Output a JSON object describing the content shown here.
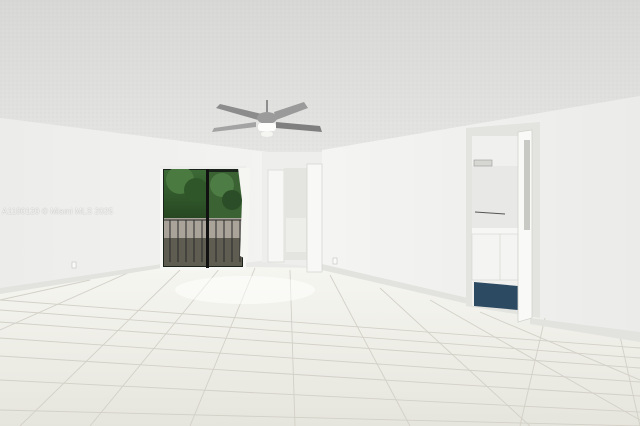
{
  "photo": {
    "watermark": "A1180120 © Miami MLS 2025"
  },
  "colors": {
    "ceiling": "#dcdcda",
    "wall_left": "#efefed",
    "wall_right": "#f1f1ef",
    "floor_tile": "#ecebe4",
    "grout": "#cfcdc4",
    "foliage": "#2f5a2c",
    "bath_rug": "#2c4a62"
  }
}
